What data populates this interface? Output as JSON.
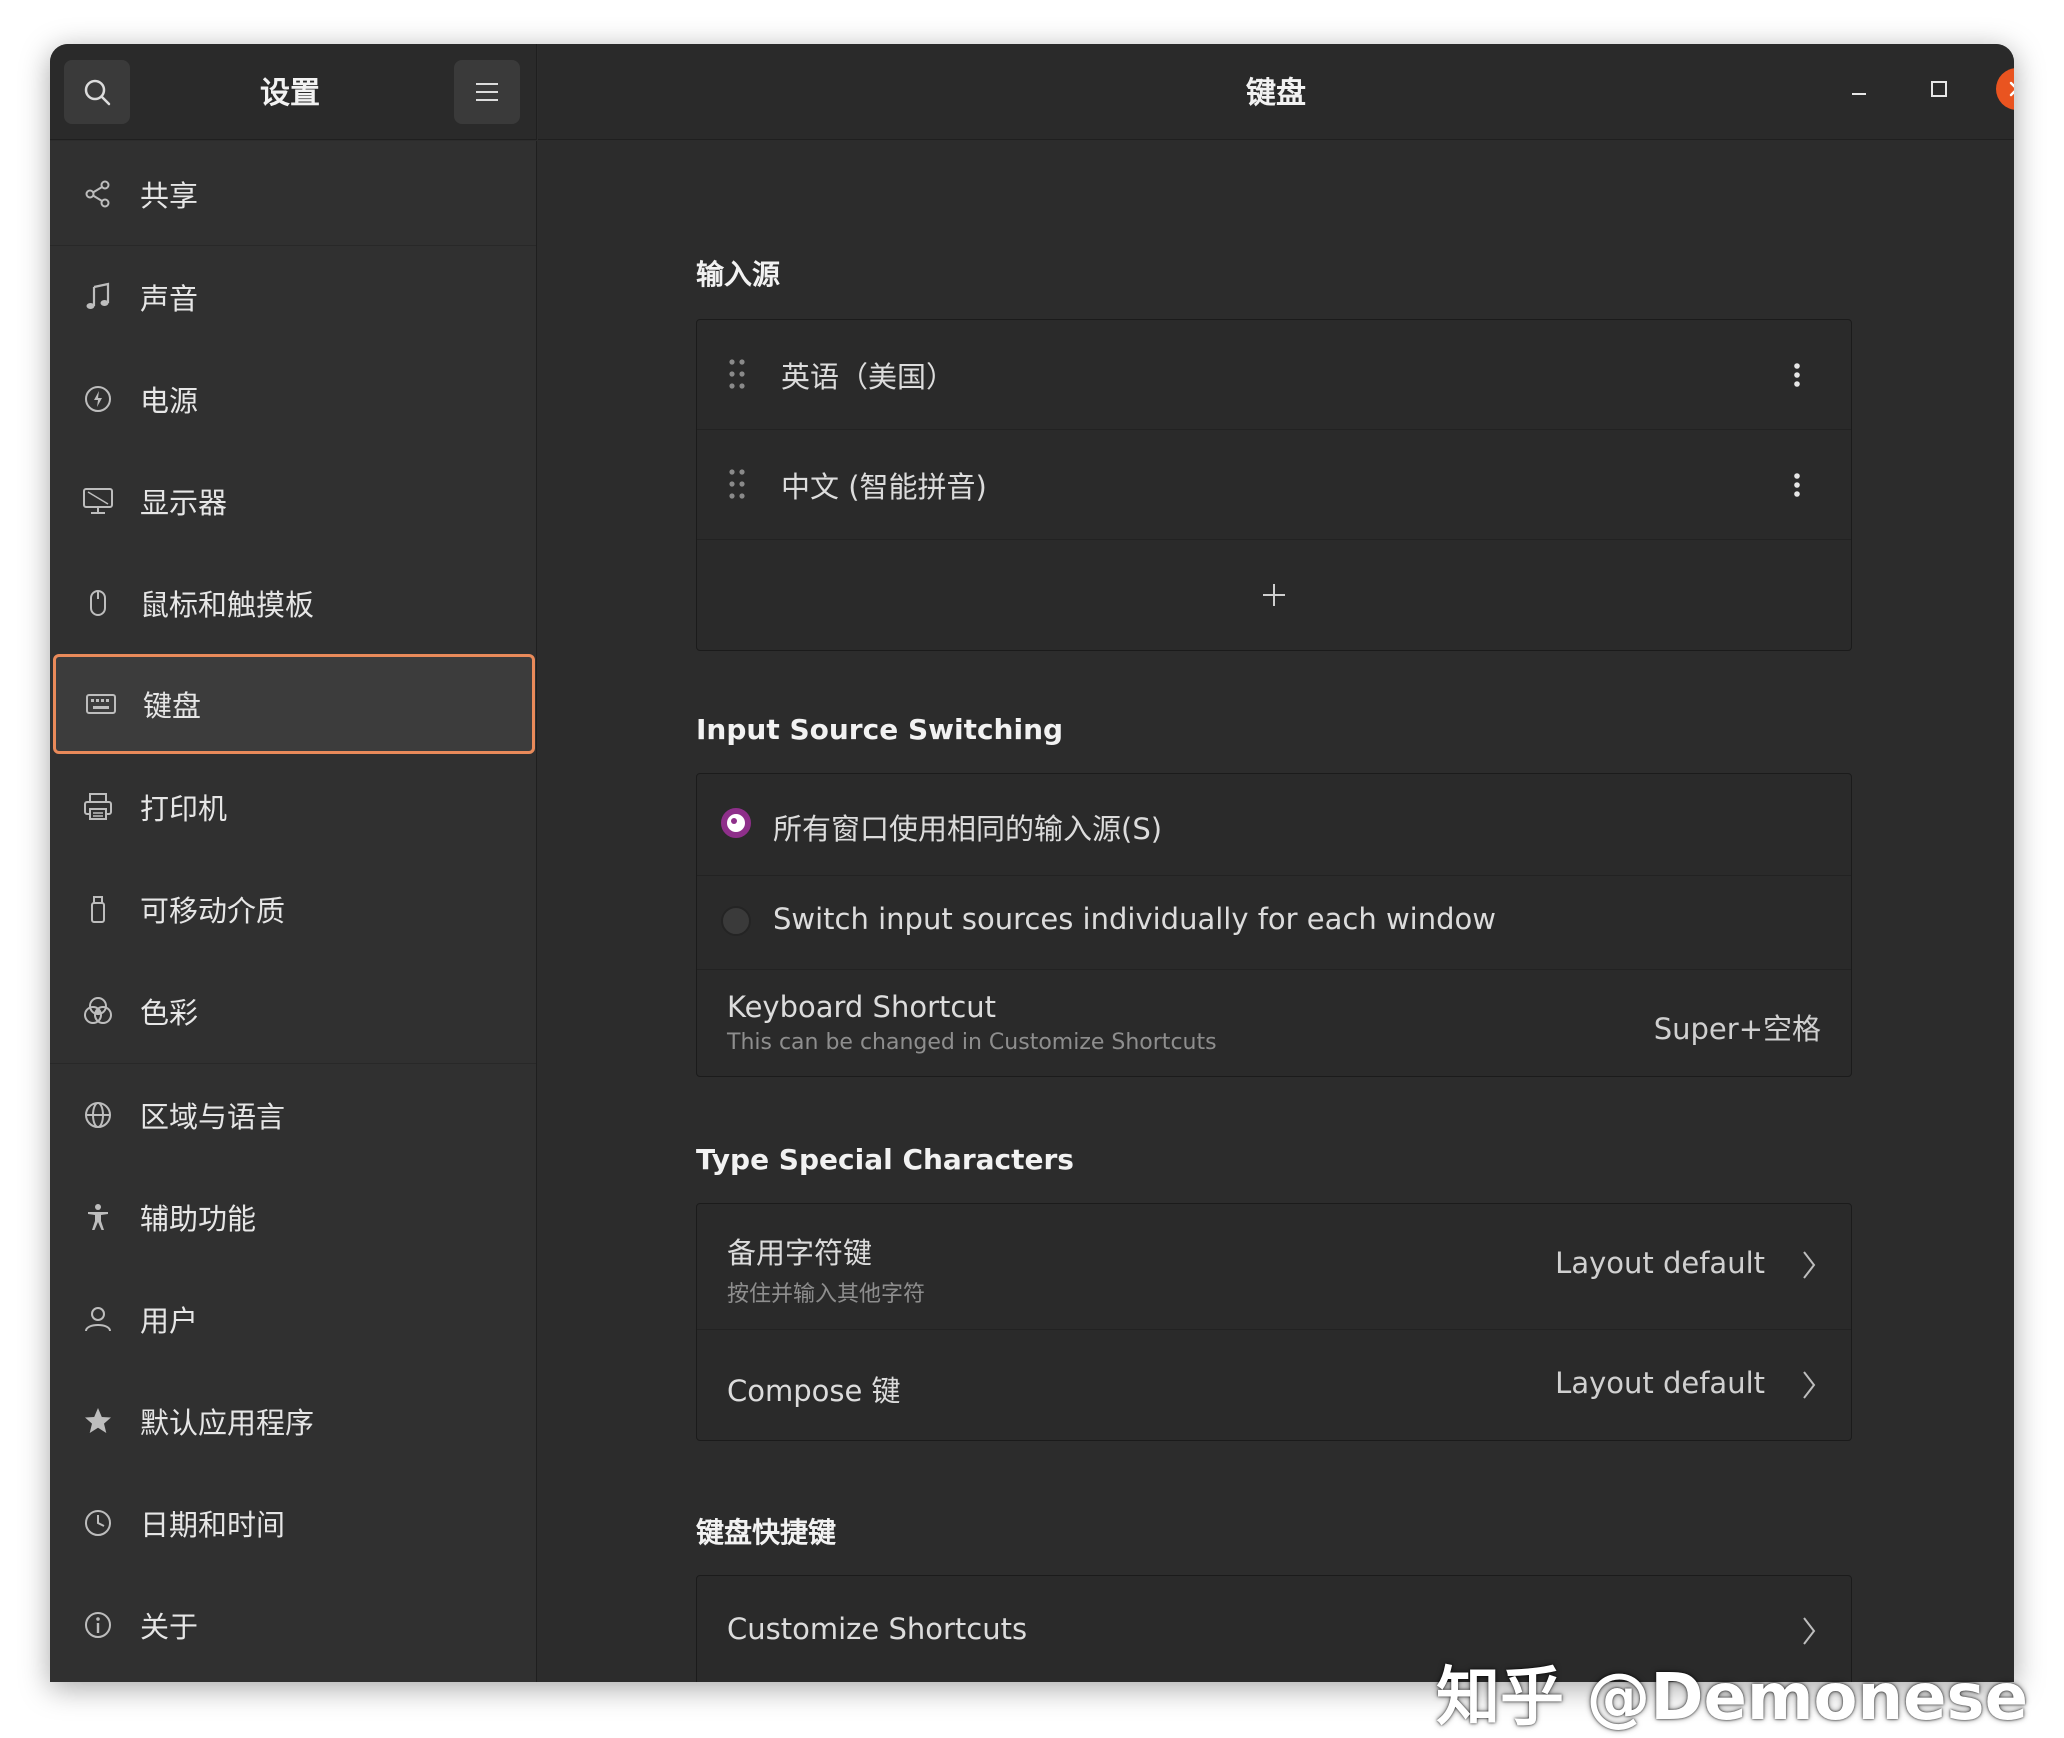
{
  "header": {
    "sidebar_title": "设置",
    "page_title": "键盘"
  },
  "sidebar": {
    "items": [
      {
        "label": "共享",
        "icon": "share-icon"
      },
      {
        "label": "声音",
        "icon": "music-note-icon"
      },
      {
        "label": "电源",
        "icon": "power-icon"
      },
      {
        "label": "显示器",
        "icon": "display-icon"
      },
      {
        "label": "鼠标和触摸板",
        "icon": "mouse-icon"
      },
      {
        "label": "键盘",
        "icon": "keyboard-icon",
        "active": true
      },
      {
        "label": "打印机",
        "icon": "printer-icon"
      },
      {
        "label": "可移动介质",
        "icon": "removable-media-icon"
      },
      {
        "label": "色彩",
        "icon": "color-icon"
      },
      {
        "label": "区域与语言",
        "icon": "globe-icon"
      },
      {
        "label": "辅助功能",
        "icon": "accessibility-icon"
      },
      {
        "label": "用户",
        "icon": "user-icon"
      },
      {
        "label": "默认应用程序",
        "icon": "star-icon"
      },
      {
        "label": "日期和时间",
        "icon": "clock-icon"
      },
      {
        "label": "关于",
        "icon": "info-icon"
      }
    ]
  },
  "input_sources": {
    "title": "输入源",
    "items": [
      "英语（美国）",
      "中文 (智能拼音)"
    ]
  },
  "switching": {
    "title": "Input Source Switching",
    "option_same": "所有窗口使用相同的输入源(S)",
    "option_individual": "Switch input sources individually for each window",
    "selected": "same",
    "shortcut_label": "Keyboard Shortcut",
    "shortcut_sub": "This can be changed in Customize Shortcuts",
    "shortcut_value": "Super+空格"
  },
  "special_chars": {
    "title": "Type Special Characters",
    "alt_label": "备用字符键",
    "alt_sub": "按住并输入其他字符",
    "alt_value": "Layout default",
    "compose_label": "Compose 键",
    "compose_value": "Layout default"
  },
  "shortcuts": {
    "title": "键盘快捷键",
    "customize_label": "Customize Shortcuts"
  },
  "watermark": "知乎 @Demonese",
  "colors": {
    "accent_orange": "#e95420",
    "active_border": "#e98a5a",
    "radio_purple": "#8e2f8a"
  }
}
